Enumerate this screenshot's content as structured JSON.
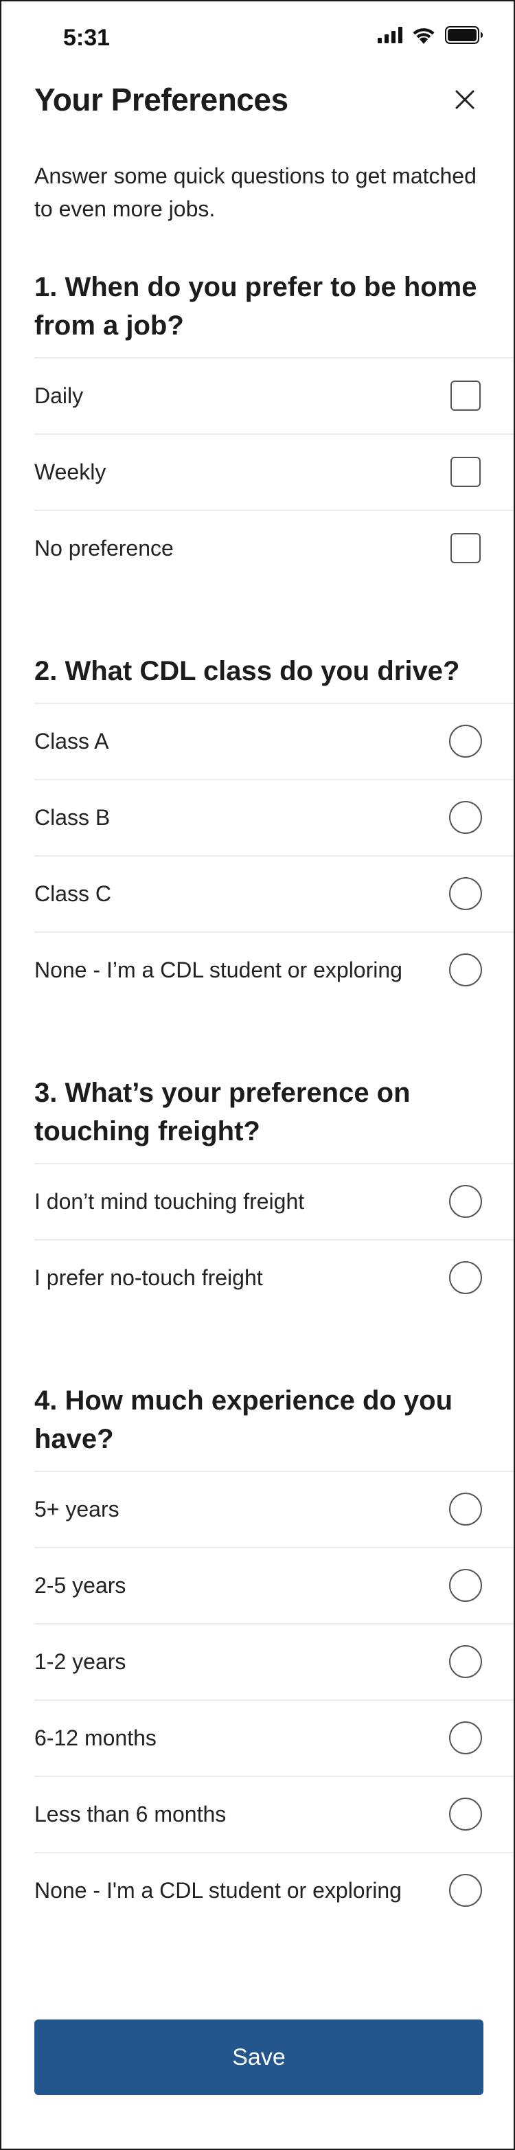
{
  "status_bar": {
    "time": "5:31",
    "icons": [
      "cellular-signal-icon",
      "wifi-icon",
      "battery-icon"
    ]
  },
  "header": {
    "title": "Your Preferences",
    "close_icon": "close-icon"
  },
  "subtitle": "Answer some quick questions to get matched to even more jobs.",
  "sections": [
    {
      "title": "1. When do you prefer to be home from a job?",
      "control": "checkbox",
      "options": [
        "Daily",
        "Weekly",
        "No preference"
      ]
    },
    {
      "title": "2. What CDL class do you drive?",
      "control": "radio",
      "options": [
        "Class A",
        "Class B",
        "Class C",
        "None - I’m a CDL student or exploring"
      ]
    },
    {
      "title": "3. What’s your preference on touching freight?",
      "control": "radio",
      "options": [
        "I don’t mind touching freight",
        "I prefer no-touch freight"
      ]
    },
    {
      "title": "4. How much experience do you have?",
      "control": "radio",
      "options": [
        "5+ years",
        "2-5 years",
        "1-2 years",
        "6-12 months",
        "Less than 6 months",
        "None - I'm a CDL student or exploring"
      ]
    }
  ],
  "save_label": "Save",
  "colors": {
    "primary": "#22568c",
    "text": "#1c1c1c",
    "divider": "#ececec",
    "control_border": "#555555"
  }
}
